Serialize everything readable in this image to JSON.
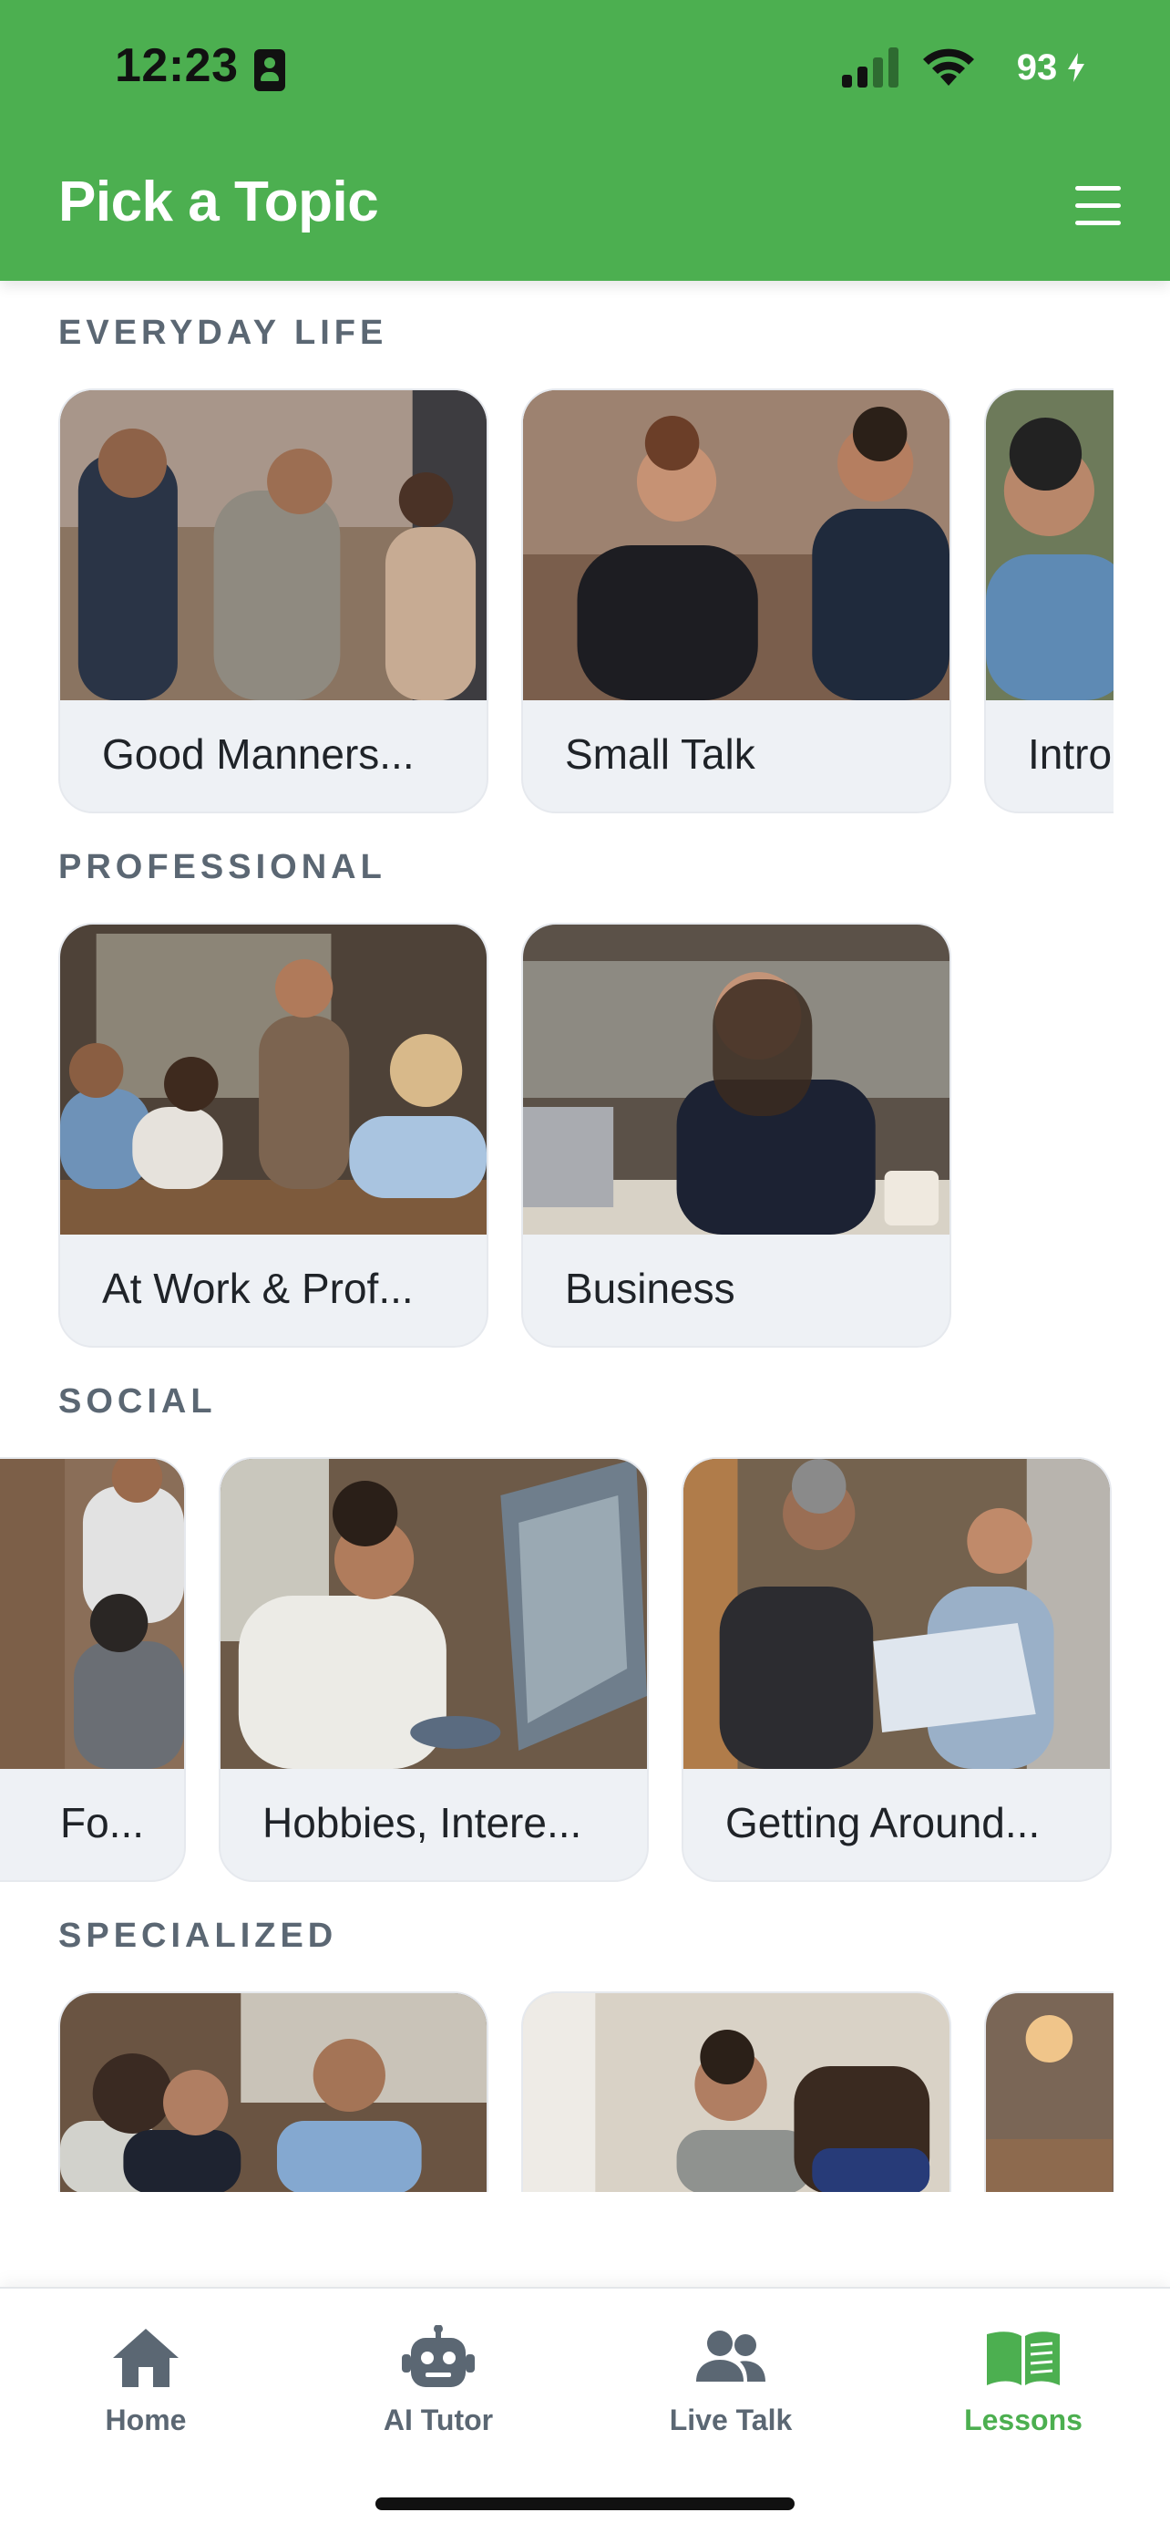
{
  "status_bar": {
    "time": "12:23",
    "battery": "93"
  },
  "header": {
    "title": "Pick a Topic"
  },
  "sections": [
    {
      "title": "EVERYDAY LIFE",
      "cards": [
        {
          "label": "Good Manners..."
        },
        {
          "label": "Small Talk"
        },
        {
          "label": "Intro"
        }
      ]
    },
    {
      "title": "PROFESSIONAL",
      "cards": [
        {
          "label": "At Work & Prof..."
        },
        {
          "label": "Business"
        }
      ]
    },
    {
      "title": "SOCIAL",
      "cards": [
        {
          "label": "Fo..."
        },
        {
          "label": "Hobbies, Intere..."
        },
        {
          "label": "Getting Around..."
        }
      ]
    },
    {
      "title": "SPECIALIZED",
      "cards": [
        {},
        {},
        {}
      ]
    }
  ],
  "bottom_nav": [
    {
      "label": "Home",
      "icon": "home-icon"
    },
    {
      "label": "AI Tutor",
      "icon": "robot-icon"
    },
    {
      "label": "Live Talk",
      "icon": "people-icon"
    },
    {
      "label": "Lessons",
      "icon": "book-icon",
      "active": true
    }
  ],
  "colors": {
    "brand_green": "#4caf50",
    "section_title": "#5b6773",
    "card_bg": "#eef1f5",
    "nav_inactive": "#5b6773"
  }
}
